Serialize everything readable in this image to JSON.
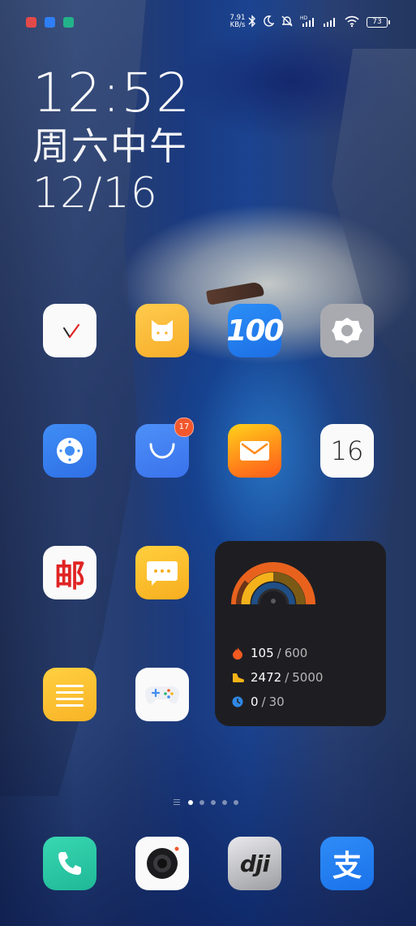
{
  "status_bar": {
    "net_speed_value": "7.91",
    "net_speed_unit": "KB/s",
    "battery_level": "73",
    "notification_icons": [
      "maps-icon",
      "upload-icon",
      "video-icon"
    ],
    "status_icons": [
      "bluetooth-icon",
      "moon-icon",
      "mute-bell-icon",
      "hd-signal-icon",
      "signal-icon",
      "wifi-icon"
    ]
  },
  "clock": {
    "time": "12:52",
    "day": "周六中午",
    "date": "12/16"
  },
  "apps": [
    {
      "id": "clock",
      "icon": "clock-icon"
    },
    {
      "id": "xiaomi-community",
      "icon": "mi-bunny-icon"
    },
    {
      "id": "kuaidi100",
      "icon": "kuaidi100-icon",
      "label": "100"
    },
    {
      "id": "settings",
      "icon": "gear-icon"
    },
    {
      "id": "mi-remote",
      "icon": "remote-icon"
    },
    {
      "id": "app-store",
      "icon": "shopping-bag-icon",
      "badge": "17"
    },
    {
      "id": "email",
      "icon": "envelope-icon"
    },
    {
      "id": "calendar",
      "icon": "calendar-icon",
      "label": "16"
    },
    {
      "id": "china-post",
      "icon": "post-icon",
      "label": "邮"
    },
    {
      "id": "messages",
      "icon": "message-bubble-icon"
    },
    {
      "id": "notes",
      "icon": "notes-icon"
    },
    {
      "id": "game-center",
      "icon": "gamepad-icon"
    },
    {
      "id": "phone",
      "icon": "phone-icon"
    },
    {
      "id": "camera",
      "icon": "camera-icon"
    },
    {
      "id": "dji",
      "icon": "dji-icon",
      "label": "dji"
    },
    {
      "id": "alipay",
      "icon": "alipay-icon",
      "label": "支"
    }
  ],
  "fitness_widget": {
    "rings_colors": [
      "#e8621e",
      "#f3b21b",
      "#2f88e5"
    ],
    "calories": {
      "value": "105",
      "goal": "600",
      "icon": "flame-icon",
      "color": "#f25a21"
    },
    "steps": {
      "value": "2472",
      "goal": "5000",
      "icon": "shoe-icon",
      "color": "#f5b318"
    },
    "minutes": {
      "value": "0",
      "goal": "30",
      "icon": "clock-circle-icon",
      "color": "#2f88e5"
    },
    "separator": "/"
  },
  "page_indicator": {
    "pages": 5,
    "active_page": 1
  }
}
